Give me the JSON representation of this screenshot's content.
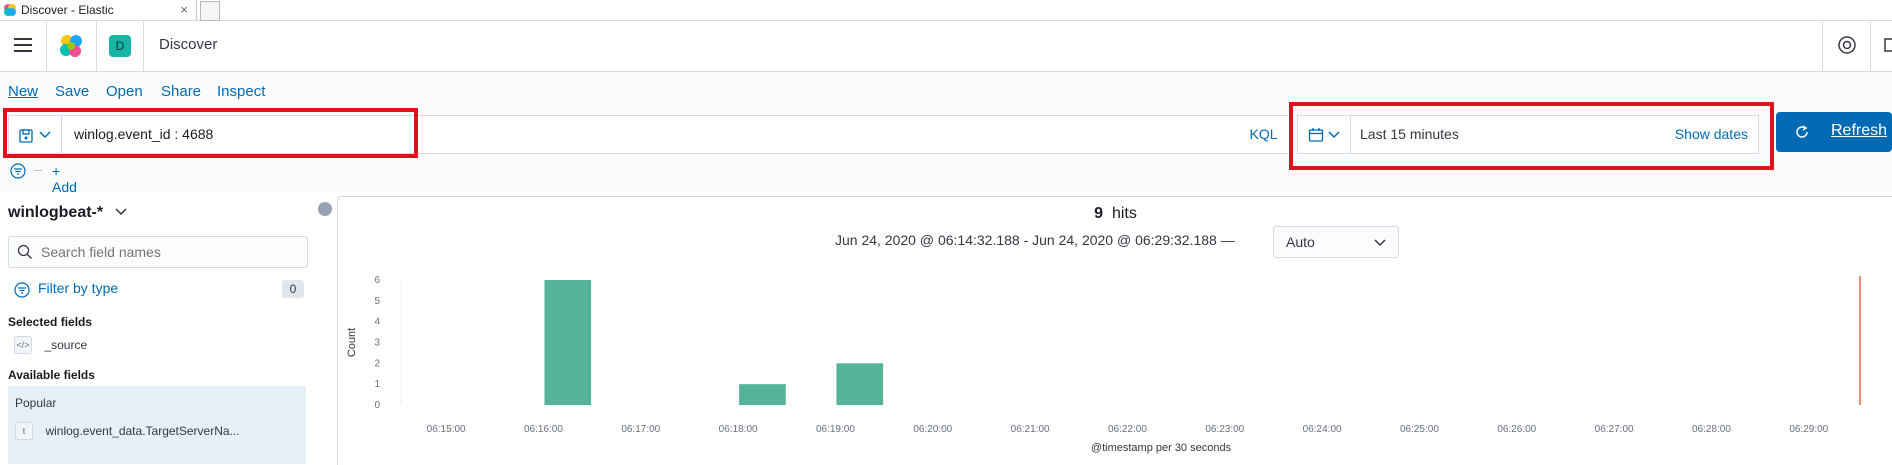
{
  "browser_tab": {
    "title": "Discover - Elastic",
    "close": "×"
  },
  "header": {
    "space_initial": "D",
    "app_title": "Discover"
  },
  "top_nav": [
    "New",
    "Save",
    "Open",
    "Share",
    "Inspect"
  ],
  "query": {
    "text": "winlog.event_id : 4688",
    "language": "KQL"
  },
  "date_picker": {
    "value": "Last 15 minutes",
    "show_dates": "Show dates"
  },
  "refresh_label": "Refresh",
  "add_filter": "+ Add filter",
  "sidebar": {
    "index_pattern": "winlogbeat-*",
    "search_placeholder": "Search field names",
    "filter_by_type": "Filter by type",
    "filter_count": "0",
    "selected_heading": "Selected fields",
    "selected_fields": [
      {
        "type": "</>",
        "name": "_source"
      }
    ],
    "available_heading": "Available fields",
    "popular_label": "Popular",
    "popular_fields": [
      {
        "type": "t",
        "name": "winlog.event_data.TargetServerNa..."
      }
    ]
  },
  "results": {
    "hits_count": "9",
    "hits_label": "hits",
    "time_range": "Jun 24, 2020 @ 06:14:32.188 - Jun 24, 2020 @ 06:29:32.188 —",
    "interval": "Auto"
  },
  "colors": {
    "bar": "#54b399",
    "accent": "#006bb4",
    "highlight": "#e0121d"
  },
  "chart_data": {
    "type": "bar",
    "x": [
      "06:16:00",
      "06:16:30",
      "06:18:00",
      "06:19:00"
    ],
    "values": [
      6,
      0,
      1,
      2
    ],
    "x_ticks": [
      "06:15:00",
      "06:16:00",
      "06:17:00",
      "06:18:00",
      "06:19:00",
      "06:20:00",
      "06:21:00",
      "06:22:00",
      "06:23:00",
      "06:24:00",
      "06:25:00",
      "06:26:00",
      "06:27:00",
      "06:28:00",
      "06:29:00"
    ],
    "y_ticks": [
      0,
      1,
      2,
      3,
      4,
      5,
      6
    ],
    "ylabel": "Count",
    "xlabel": "@timestamp per 30 seconds",
    "ylim": [
      0,
      6
    ],
    "grid": false
  }
}
